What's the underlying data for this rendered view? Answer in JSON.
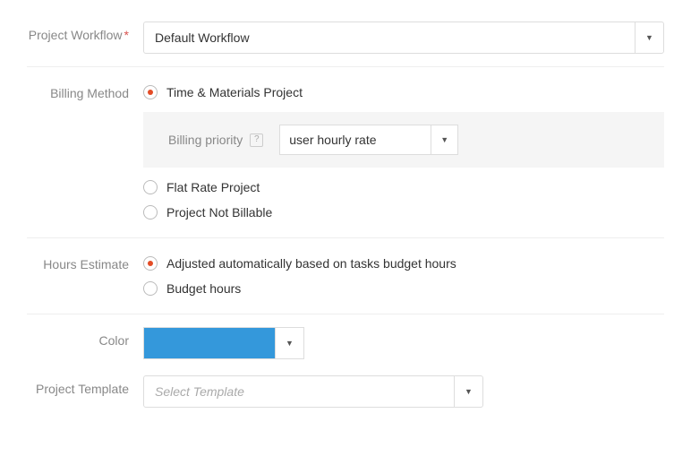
{
  "workflow": {
    "label": "Project Workflow",
    "required_marker": "*",
    "value": "Default Workflow"
  },
  "billing": {
    "label": "Billing Method",
    "options": {
      "time_materials": "Time & Materials Project",
      "flat_rate": "Flat Rate Project",
      "not_billable": "Project Not Billable"
    },
    "priority": {
      "label": "Billing priority",
      "help": "?",
      "value": "user hourly rate"
    }
  },
  "hours": {
    "label": "Hours Estimate",
    "options": {
      "auto": "Adjusted automatically based on tasks budget hours",
      "budget": "Budget hours"
    }
  },
  "color": {
    "label": "Color",
    "value": "#3498db"
  },
  "template": {
    "label": "Project Template",
    "placeholder": "Select Template"
  },
  "caret": "▼"
}
